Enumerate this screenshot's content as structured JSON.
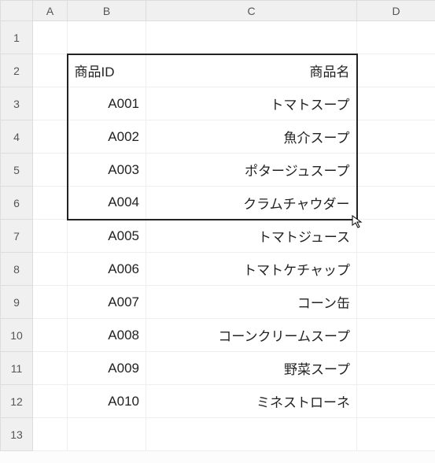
{
  "columns": {
    "A": "A",
    "B": "B",
    "C": "C",
    "D": "D"
  },
  "rows": [
    "1",
    "2",
    "3",
    "4",
    "5",
    "6",
    "7",
    "8",
    "9",
    "10",
    "11",
    "12",
    "13"
  ],
  "table": {
    "header": {
      "id": "商品ID",
      "name": "商品名"
    },
    "data": [
      {
        "id": "A001",
        "name": "トマトスープ"
      },
      {
        "id": "A002",
        "name": "魚介スープ"
      },
      {
        "id": "A003",
        "name": "ポタージュスープ"
      },
      {
        "id": "A004",
        "name": "クラムチャウダー"
      },
      {
        "id": "A005",
        "name": "トマトジュース"
      },
      {
        "id": "A006",
        "name": "トマトケチャップ"
      },
      {
        "id": "A007",
        "name": "コーン缶"
      },
      {
        "id": "A008",
        "name": "コーンクリームスープ"
      },
      {
        "id": "A009",
        "name": "野菜スープ"
      },
      {
        "id": "A010",
        "name": "ミネストローネ"
      }
    ]
  },
  "selection": {
    "from": "B2",
    "to": "C6"
  }
}
